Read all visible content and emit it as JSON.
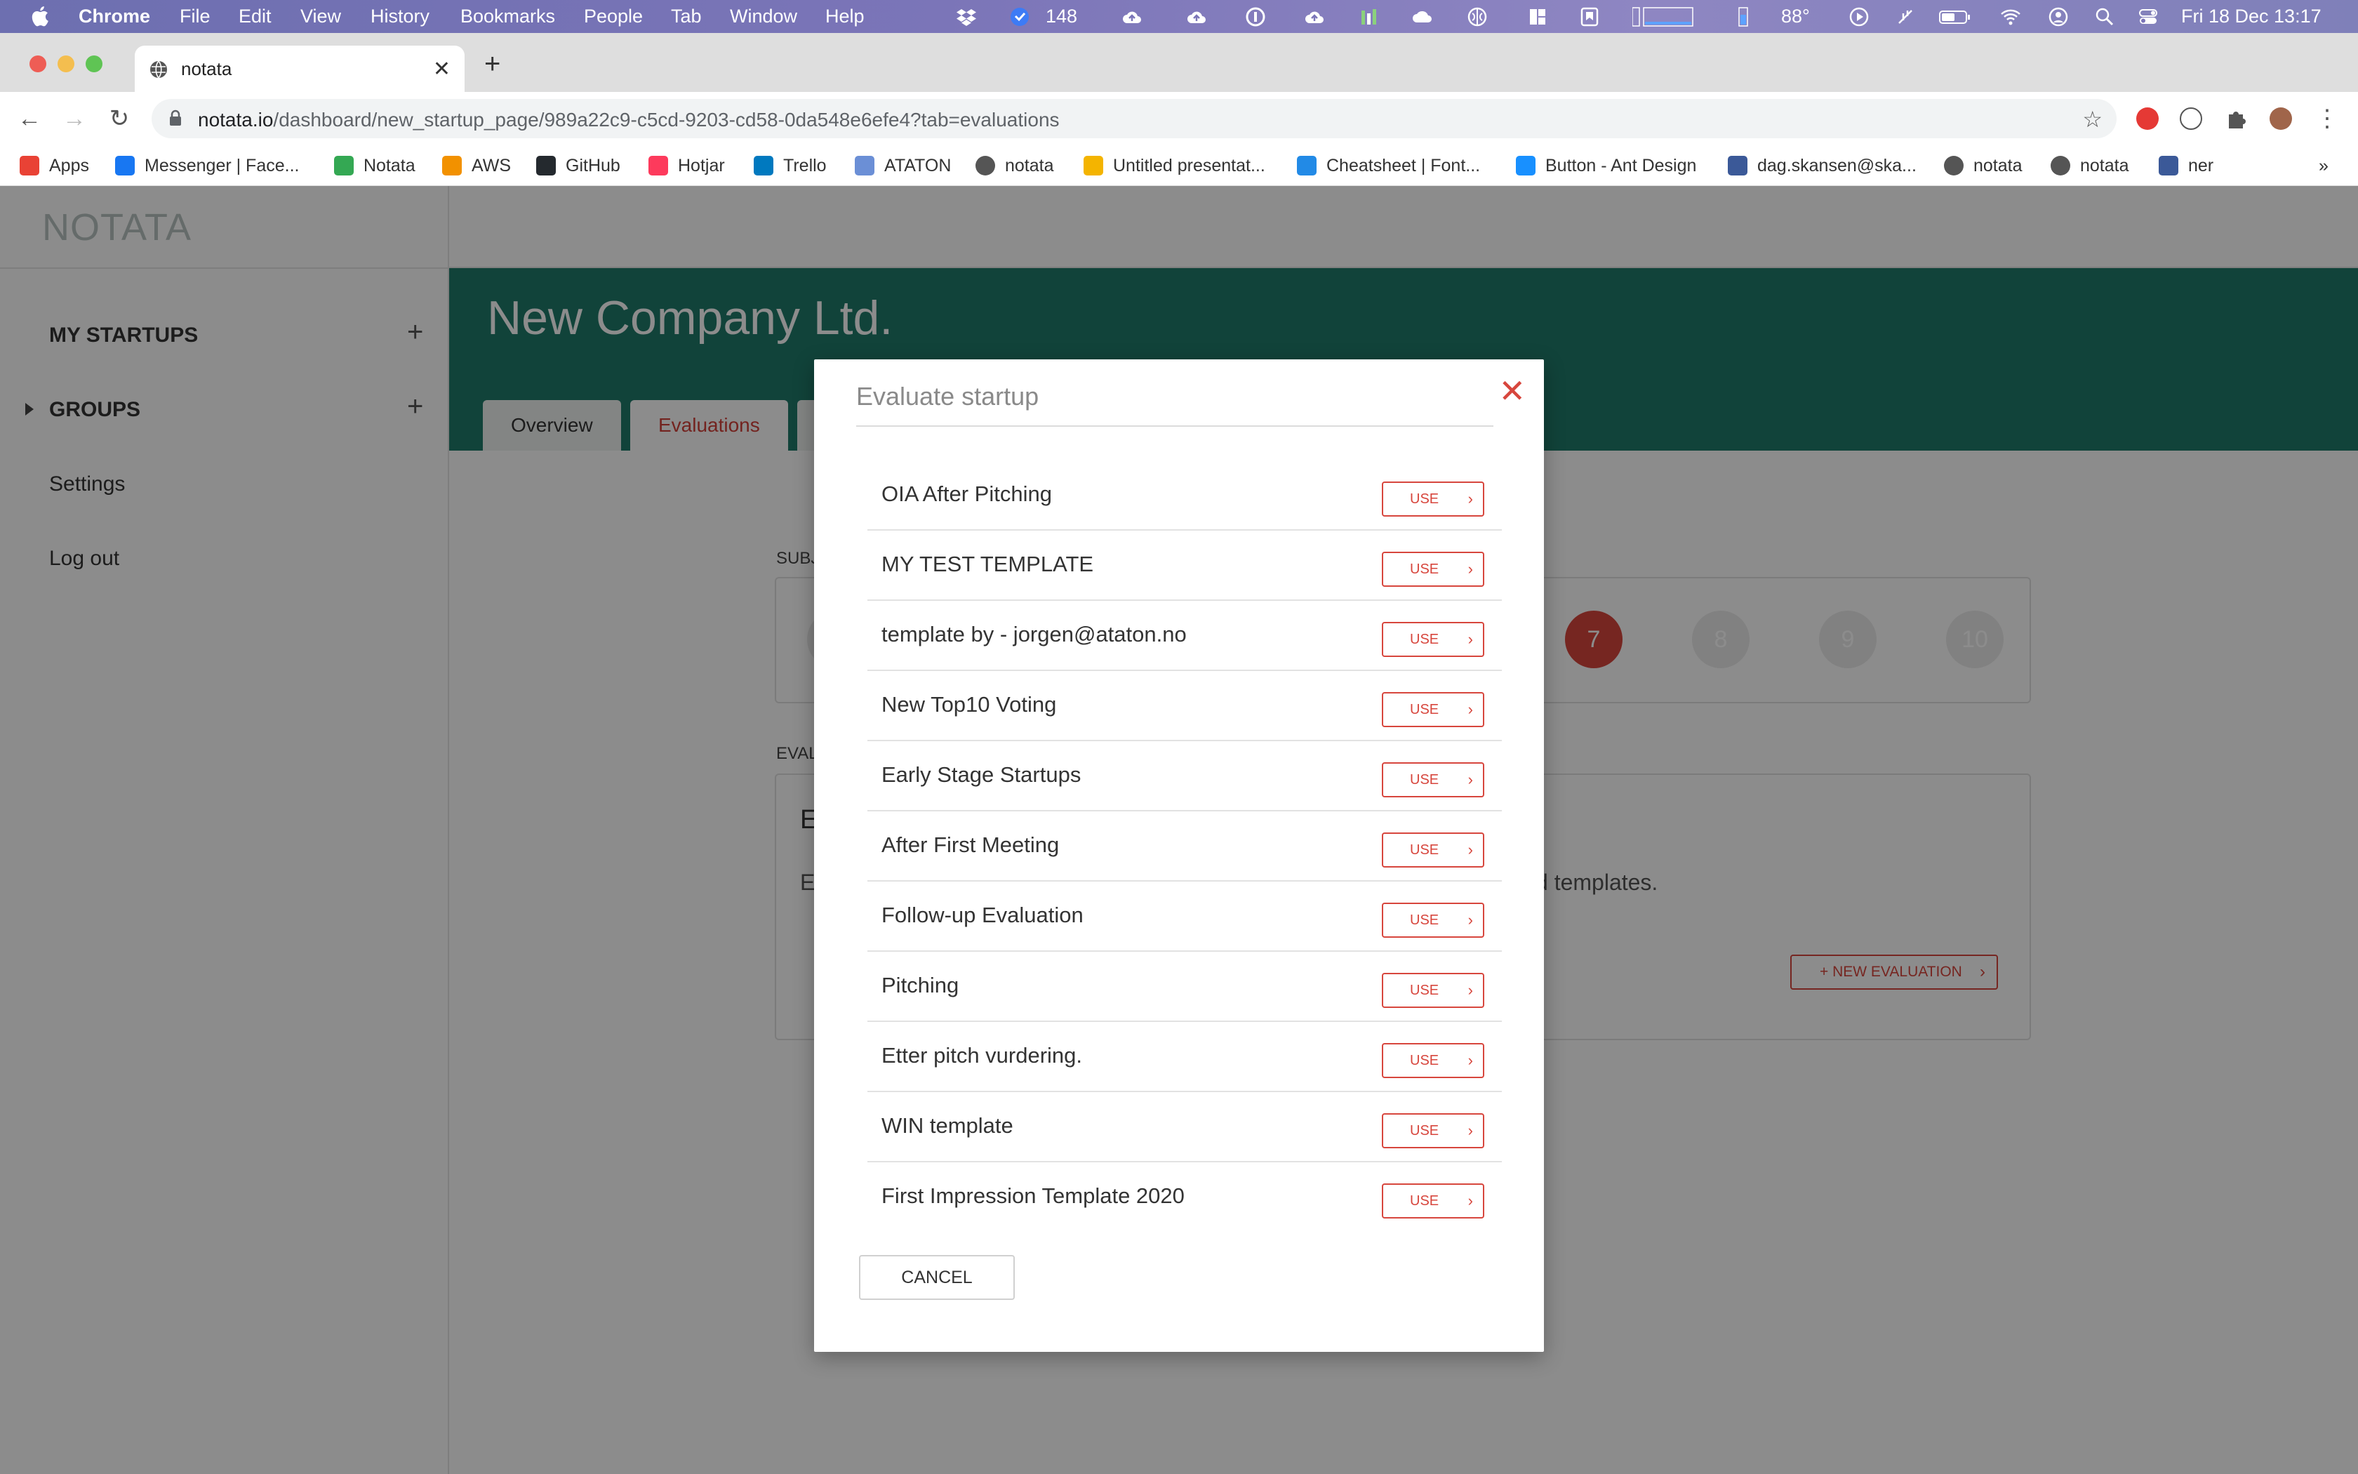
{
  "menubar": {
    "app": "Chrome",
    "items": [
      "File",
      "Edit",
      "View",
      "History",
      "Bookmarks",
      "People",
      "Tab",
      "Window",
      "Help"
    ],
    "badge_count": "148",
    "temperature": "88°",
    "datetime": "Fri 18 Dec  13:17"
  },
  "browser": {
    "tab_title": "notata",
    "url_host": "notata.io",
    "url_path": "/dashboard/new_startup_page/989a22c9-c5cd-9203-cd58-0da548e6efe4?tab=evaluations",
    "bookmarks": [
      {
        "label": "Apps",
        "icon": "apps-grid-icon",
        "color": "#e94235"
      },
      {
        "label": "Messenger | Face...",
        "icon": "facebook-icon",
        "color": "#1877f2"
      },
      {
        "label": "Notata",
        "icon": "google-drive-icon",
        "color": "#34a853"
      },
      {
        "label": "AWS",
        "icon": "aws-cube-icon",
        "color": "#f29100"
      },
      {
        "label": "GitHub",
        "icon": "github-icon",
        "color": "#24292e"
      },
      {
        "label": "Hotjar",
        "icon": "hotjar-flame-icon",
        "color": "#fd3a5c"
      },
      {
        "label": "Trello",
        "icon": "trello-icon",
        "color": "#0079bf"
      },
      {
        "label": "ATATON",
        "icon": "ataton-icon",
        "color": "#6b8fd6"
      },
      {
        "label": "notata",
        "icon": "globe-icon",
        "color": "#555555"
      },
      {
        "label": "Untitled presentat...",
        "icon": "slides-icon",
        "color": "#f4b400"
      },
      {
        "label": "Cheatsheet | Font...",
        "icon": "fontawesome-flag-icon",
        "color": "#228ae6"
      },
      {
        "label": "Button - Ant Design",
        "icon": "ant-design-icon",
        "color": "#1890ff"
      },
      {
        "label": "dag.skansen@ska...",
        "icon": "database-icon",
        "color": "#3b5998"
      },
      {
        "label": "notata",
        "icon": "globe-icon",
        "color": "#555555"
      },
      {
        "label": "notata",
        "icon": "globe-icon",
        "color": "#555555"
      },
      {
        "label": "ner",
        "icon": "database-icon",
        "color": "#3b5998"
      }
    ],
    "overflow": "»"
  },
  "sidebar": {
    "logo": "NOTATA",
    "items": [
      {
        "label": "MY STARTUPS",
        "has_add": true
      },
      {
        "label": "GROUPS",
        "has_add": true,
        "has_caret": true
      },
      {
        "label": "Settings"
      },
      {
        "label": "Log out"
      }
    ]
  },
  "header": {
    "company": "New Company Ltd.",
    "tabs": [
      {
        "label": "Overview",
        "active": false
      },
      {
        "label": "Evaluations",
        "active": true
      }
    ],
    "accent": "#1f7a6a"
  },
  "content": {
    "subjective_label": "SUBJ",
    "scores": [
      "7",
      "8",
      "9",
      "10"
    ],
    "selected_score": "7",
    "evaluation_label": "EVAL",
    "evaluation_heading": "E",
    "evaluation_text_start": "E",
    "evaluation_text_end": "d templates.",
    "new_evaluation_label": "+ NEW EVALUATION"
  },
  "modal": {
    "title": "Evaluate startup",
    "use_label": "USE",
    "cancel_label": "CANCEL",
    "templates": [
      "OIA After Pitching",
      "MY TEST TEMPLATE",
      "template by - jorgen@ataton.no",
      "New Top10 Voting",
      "Early Stage Startups",
      "After First Meeting",
      "Follow-up Evaluation",
      "Pitching",
      "Etter pitch vurdering.",
      "WIN template",
      "First Impression Template 2020"
    ]
  },
  "colors": {
    "danger": "#d7463d"
  }
}
